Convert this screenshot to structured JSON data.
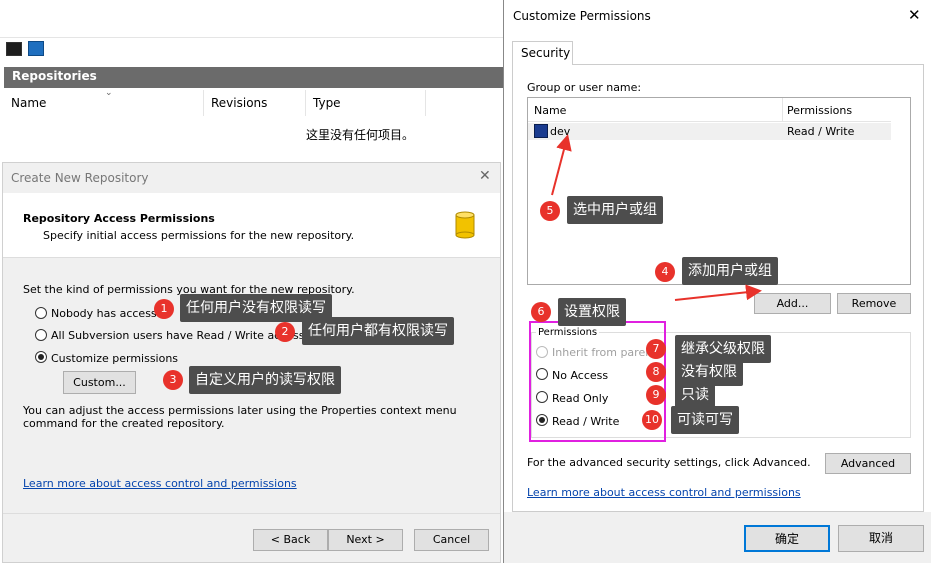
{
  "background_window": {
    "repositories_header": "Repositories",
    "columns": [
      "Name",
      "Revisions",
      "Type"
    ],
    "empty_message": "这里没有任何项目。"
  },
  "create_dialog": {
    "title": "Create New Repository",
    "close": "✕",
    "heading": "Repository Access Permissions",
    "subheading": "Specify initial access permissions for the new repository.",
    "prompt": "Set the kind of permissions you want for the new repository.",
    "options": [
      {
        "label": "Nobody has access",
        "selected": false
      },
      {
        "label": "All Subversion users have Read / Write access",
        "selected": false
      },
      {
        "label": "Customize permissions",
        "selected": true
      }
    ],
    "custom_button": "Custom...",
    "adjust_text": "You can adjust the access permissions later using the Properties context menu command for the created repository.",
    "learn_more_link": "Learn more about access control and permissions",
    "back_button": "< Back",
    "next_button": "Next >",
    "cancel_button": "Cancel"
  },
  "permissions_dialog": {
    "title": "Customize Permissions",
    "close": "✕",
    "tab": "Security",
    "group_label": "Group or user name:",
    "list_columns": [
      "Name",
      "Permissions"
    ],
    "users": [
      {
        "name": "dev",
        "permissions": "Read / Write"
      }
    ],
    "add_button": "Add...",
    "remove_button": "Remove",
    "permissions_label": "Permissions",
    "options": [
      {
        "label": "Inherit from parent",
        "selected": false,
        "disabled": true
      },
      {
        "label": "No Access",
        "selected": false,
        "disabled": false
      },
      {
        "label": "Read Only",
        "selected": false,
        "disabled": false
      },
      {
        "label": "Read / Write",
        "selected": true,
        "disabled": false
      }
    ],
    "advanced_text": "For the advanced security settings, click Advanced.",
    "advanced_button": "Advanced",
    "learn_more_link": "Learn more about access control and permissions",
    "ok_button": "确定",
    "cancel_button": "取消"
  },
  "annotations": [
    {
      "num": "1",
      "text": "任何用户没有权限读写"
    },
    {
      "num": "2",
      "text": "任何用户都有权限读写"
    },
    {
      "num": "3",
      "text": "自定义用户的读写权限"
    },
    {
      "num": "4",
      "text": "添加用户或组"
    },
    {
      "num": "5",
      "text": "选中用户或组"
    },
    {
      "num": "6",
      "text": "设置权限"
    },
    {
      "num": "7",
      "text": "继承父级权限"
    },
    {
      "num": "8",
      "text": "没有权限"
    },
    {
      "num": "9",
      "text": "只读"
    },
    {
      "num": "10",
      "text": "可读可写"
    }
  ],
  "colors": {
    "annotation_badge": "#e8322b",
    "annotation_note": "#4d4d4d",
    "highlight_box": "#e020e0",
    "link": "#0645ad"
  }
}
